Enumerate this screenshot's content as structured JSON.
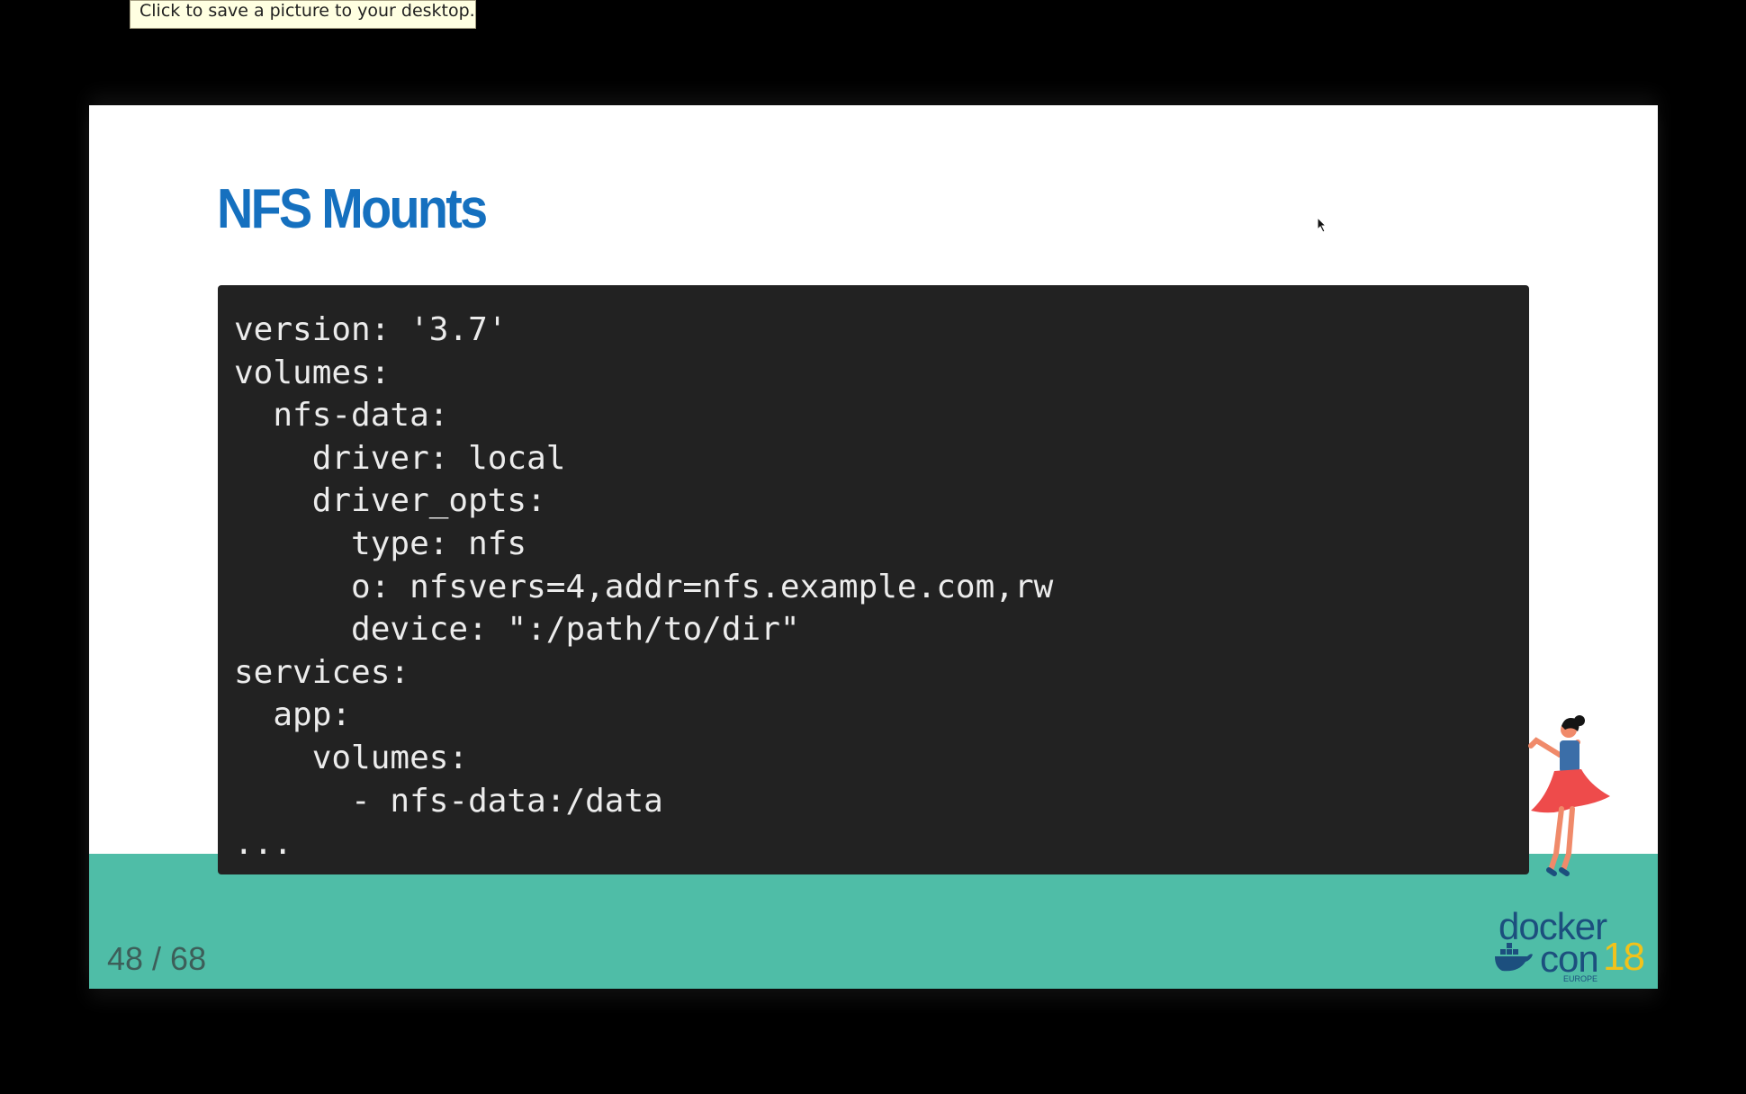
{
  "tooltip": {
    "text": "Click to save a picture to your desktop."
  },
  "slide": {
    "title": "NFS Mounts",
    "code_lines": [
      "version: '3.7'",
      "volumes:",
      "  nfs-data:",
      "    driver: local",
      "    driver_opts:",
      "      type: nfs",
      "      o: nfsvers=4,addr=nfs.example.com,rw",
      "      device: \":/path/to/dir\"",
      "services:",
      "  app:",
      "    volumes:",
      "      - nfs-data:/data",
      "..."
    ],
    "page_number": "48 / 68"
  },
  "logo": {
    "line1": "docker",
    "line2": "con",
    "number": "18",
    "sub": "EUROPE"
  },
  "icons": {
    "cursor": "mouse-pointer-icon",
    "dancer": "dancer-illustration",
    "whale": "docker-whale-icon"
  },
  "colors": {
    "title": "#1570bf",
    "code_bg": "#222222",
    "code_text": "#ececec",
    "footer_band": "#4fbda7",
    "logo_blue": "#1c4f7e",
    "logo_yellow": "#f2c21a",
    "tooltip_bg": "#ffffe1"
  }
}
